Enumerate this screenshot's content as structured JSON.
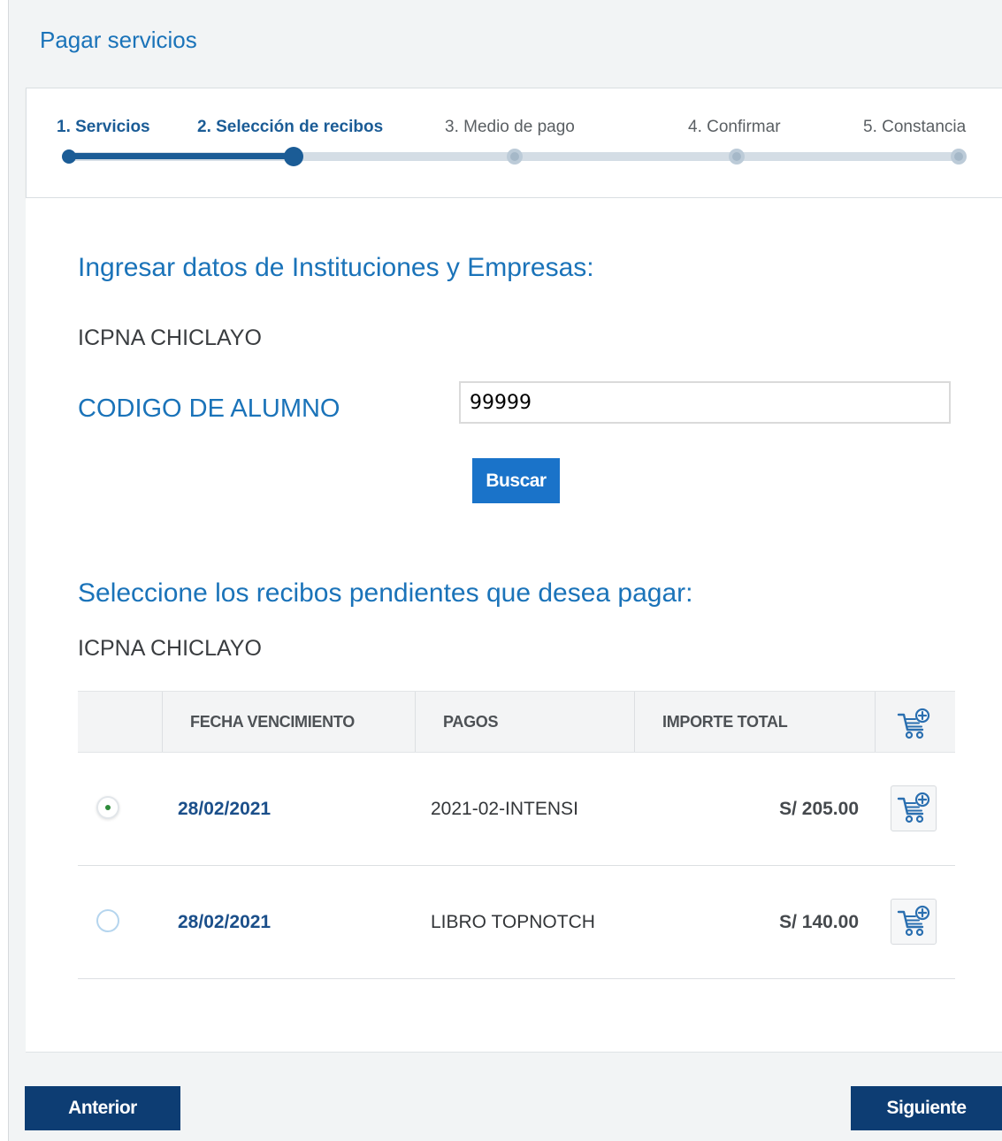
{
  "header": {
    "title": "Pagar servicios"
  },
  "stepper": {
    "steps": [
      {
        "label": "1. Servicios"
      },
      {
        "label": "2. Selección de recibos"
      },
      {
        "label": "3. Medio de pago"
      },
      {
        "label": "4. Confirmar"
      },
      {
        "label": "5. Constancia"
      }
    ],
    "current_step": 2
  },
  "search": {
    "title": "Ingresar datos de Instituciones y Empresas:",
    "institution": "ICPNA CHICLAYO",
    "field_label": "CODIGO DE ALUMNO",
    "field_value": "99999",
    "button_label": "Buscar"
  },
  "receipts": {
    "title": "Seleccione los recibos pendientes que desea pagar:",
    "institution": "ICPNA CHICLAYO",
    "columns": [
      "FECHA VENCIMIENTO",
      "PAGOS",
      "IMPORTE TOTAL"
    ],
    "header_icon": "cart-add-icon",
    "rows": [
      {
        "selected": true,
        "date": "28/02/2021",
        "payment": "2021-02-INTENSI",
        "amount": "S/ 205.00"
      },
      {
        "selected": false,
        "date": "28/02/2021",
        "payment": "LIBRO TOPNOTCH",
        "amount": "S/ 140.00"
      }
    ]
  },
  "footer": {
    "prev_label": "Anterior",
    "next_label": "Siguiente"
  },
  "colors": {
    "accent": "#1a73b9",
    "primary_dark": "#0d3d73",
    "button_blue": "#1a73c9",
    "selected_dot": "#2e8b3a"
  }
}
